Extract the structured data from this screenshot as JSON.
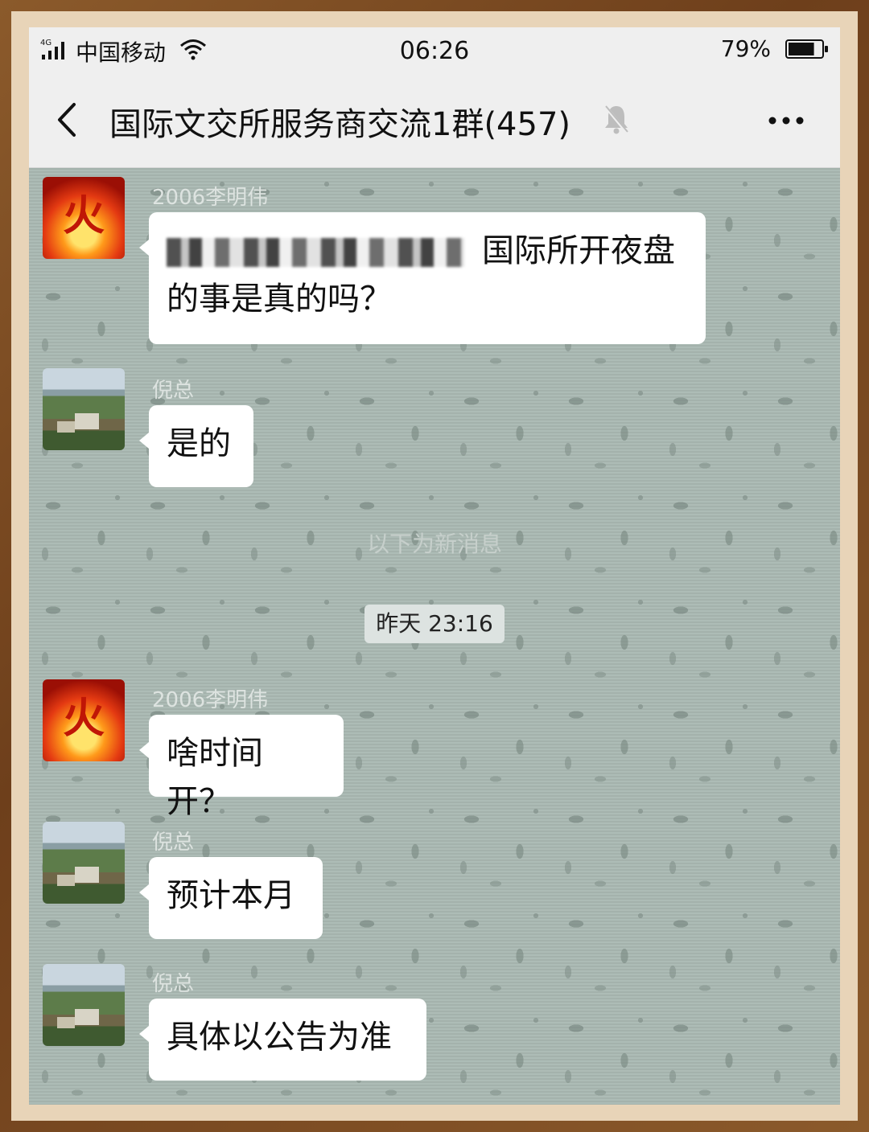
{
  "status_bar": {
    "network": "4G",
    "carrier": "中国移动",
    "time": "06:26",
    "battery": "79%",
    "battery_level": 0.79
  },
  "nav": {
    "title": "国际文交所服务商交流1群(457)",
    "back_icon": "chevron-left-icon",
    "mute_icon": "bell-off-icon",
    "more_icon": "more-dots-icon"
  },
  "chat": {
    "new_messages_divider": "以下为新消息",
    "timestamp": "昨天 23:16",
    "messages": [
      {
        "sender": "2006李明伟",
        "avatar": "fire-avatar",
        "text_line1": "国际所开夜盘",
        "text_line2": "的事是真的吗？",
        "has_redacted": true
      },
      {
        "sender": "倪总",
        "avatar": "landscape-avatar",
        "text": "是的"
      },
      {
        "sender": "2006李明伟",
        "avatar": "fire-avatar",
        "text": "啥时间开？"
      },
      {
        "sender": "倪总",
        "avatar": "landscape-avatar",
        "text": "预计本月"
      },
      {
        "sender": "倪总",
        "avatar": "landscape-avatar",
        "text": "具体以公告为准"
      }
    ]
  },
  "colors": {
    "frame": "#7a4a23",
    "chat_background": "#a9b8b2",
    "bubble": "#ffffff",
    "bar": "#efefef"
  }
}
